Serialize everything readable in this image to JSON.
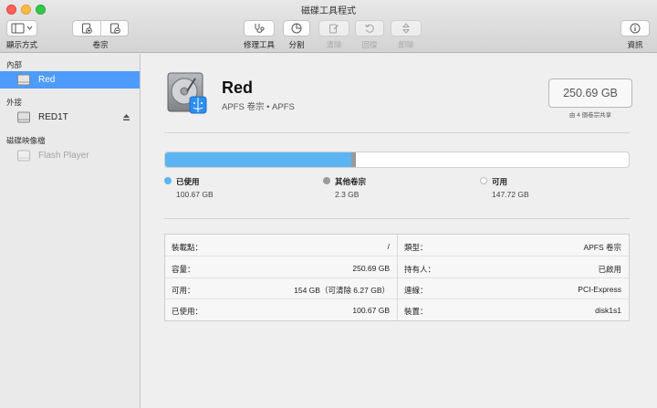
{
  "window": {
    "title": "磁碟工具程式"
  },
  "toolbar": {
    "view_label": "顯示方式",
    "volume_label": "卷宗",
    "first_aid_label": "修理工具",
    "partition_label": "分割",
    "erase_label": "清除",
    "restore_label": "回復",
    "unmount_label": "卸除",
    "info_label": "資訊"
  },
  "sidebar": {
    "sections": [
      {
        "title": "內部",
        "items": [
          {
            "label": "Red",
            "icon": "disk-volume-icon",
            "selected": true
          }
        ]
      },
      {
        "title": "外接",
        "items": [
          {
            "label": "RED1T",
            "icon": "external-disk-icon",
            "eject": "eject-icon"
          }
        ]
      },
      {
        "title": "磁碟映像檔",
        "items": [
          {
            "label": "Flash Player",
            "icon": "disk-image-icon",
            "dimmed": true
          }
        ]
      }
    ]
  },
  "volume": {
    "name": "Red",
    "subtitle": "APFS 卷宗 • APFS",
    "capacity": "250.69 GB",
    "shared_note": "由 4 個卷宗共享",
    "icon": "internal-hard-drive-icon"
  },
  "usage": {
    "used_fraction": 0.4015,
    "other_fraction": 0.0092,
    "legend": [
      {
        "name": "已使用",
        "value": "100.67 GB",
        "color": "#5ab5f2"
      },
      {
        "name": "其他卷宗",
        "value": "2.3 GB",
        "color": "#9a9a9a"
      },
      {
        "name": "可用",
        "value": "147.72 GB",
        "color": "#ffffff"
      }
    ]
  },
  "info": {
    "left": [
      {
        "key": "裝載點：",
        "value": "/"
      },
      {
        "key": "容量：",
        "value": "250.69 GB"
      },
      {
        "key": "可用：",
        "value": "154 GB（可清除 6.27 GB）"
      },
      {
        "key": "已使用：",
        "value": "100.67 GB"
      }
    ],
    "right": [
      {
        "key": "類型：",
        "value": "APFS 卷宗"
      },
      {
        "key": "持有人：",
        "value": "已啟用"
      },
      {
        "key": "連線：",
        "value": "PCI-Express"
      },
      {
        "key": "裝置：",
        "value": "disk1s1"
      }
    ]
  }
}
